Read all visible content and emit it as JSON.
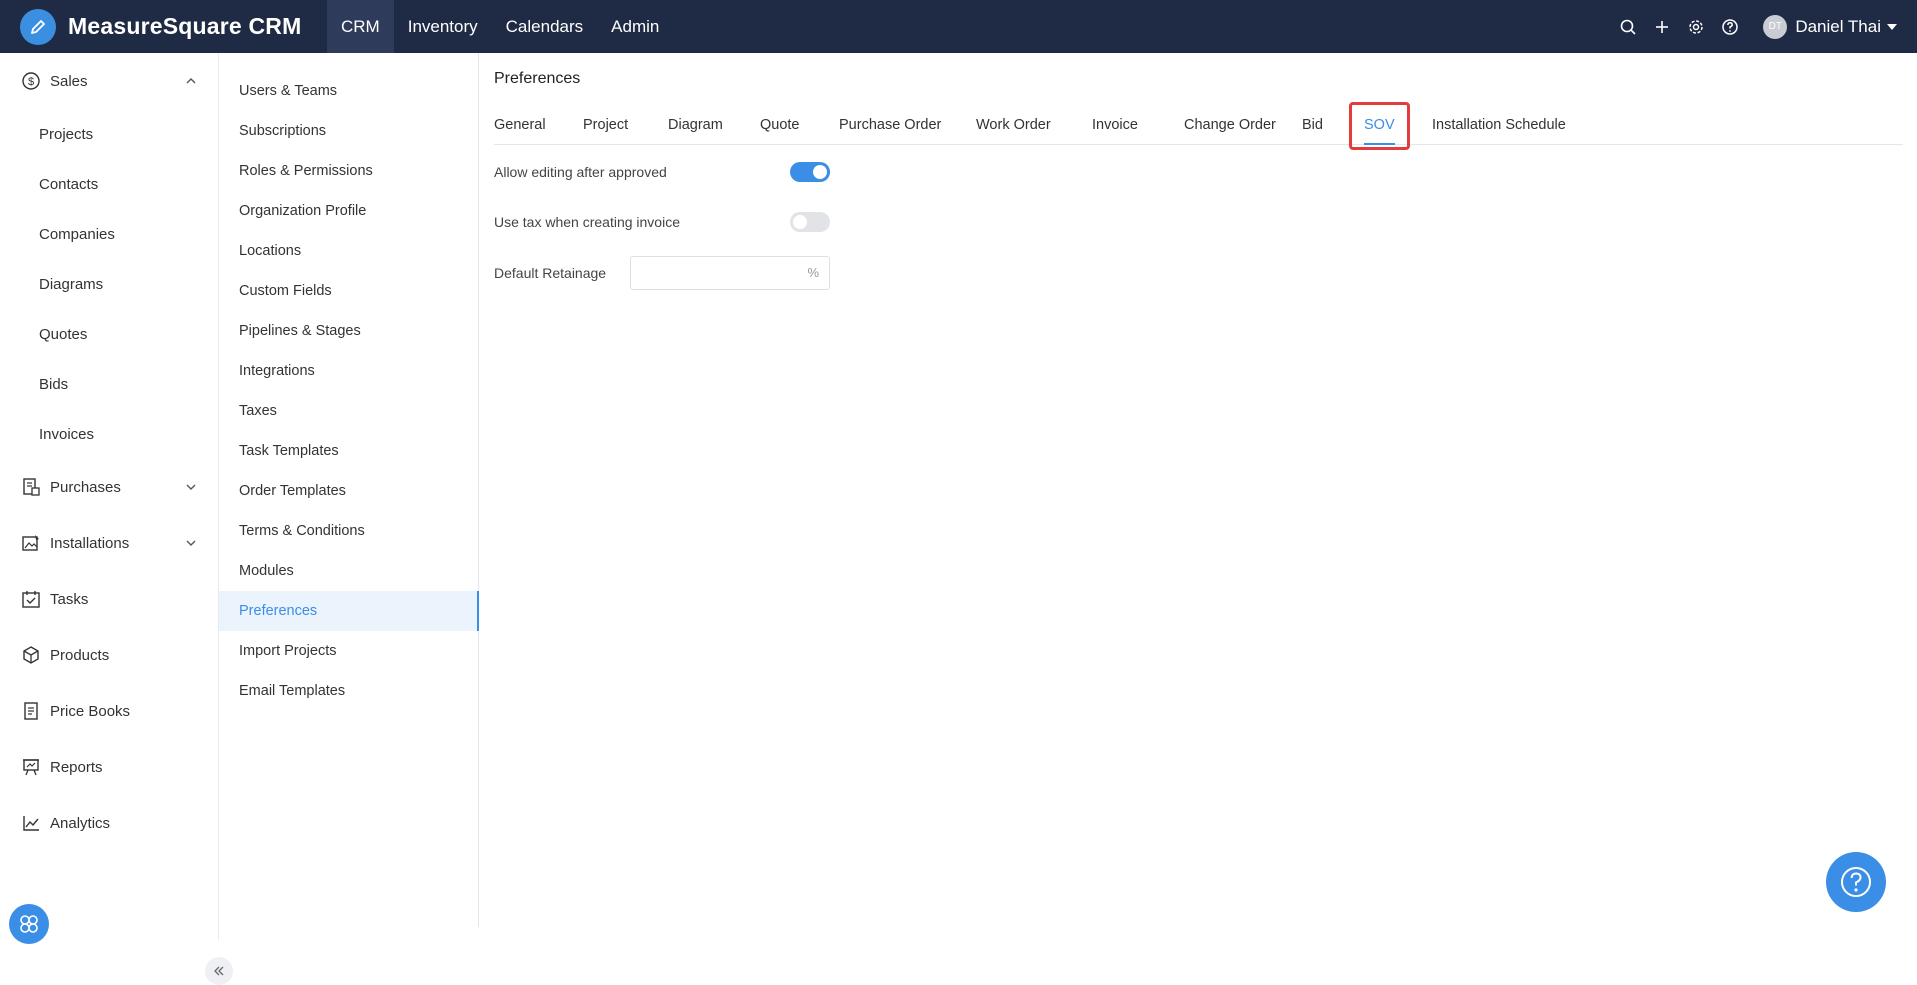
{
  "app": {
    "name": "MeasureSquare CRM",
    "accent": "#3a8ee6",
    "topbar_color": "#1f2a44"
  },
  "topnav": {
    "items": [
      {
        "label": "CRM",
        "active": true
      },
      {
        "label": "Inventory"
      },
      {
        "label": "Calendars"
      },
      {
        "label": "Admin"
      }
    ]
  },
  "topbar_icons": [
    "search-icon",
    "plus-icon",
    "gear-icon",
    "help-icon"
  ],
  "user": {
    "initials": "DT",
    "name": "Daniel Thai"
  },
  "sidebar": {
    "groups": [
      {
        "label": "Sales",
        "icon": "dollar-circle-icon",
        "expanded": true
      },
      {
        "label": "Purchases",
        "icon": "purchases-icon"
      },
      {
        "label": "Installations",
        "icon": "installations-icon"
      },
      {
        "label": "Tasks",
        "icon": "calendar-check-icon"
      },
      {
        "label": "Products",
        "icon": "box-icon"
      },
      {
        "label": "Price Books",
        "icon": "document-icon"
      },
      {
        "label": "Reports",
        "icon": "presentation-icon"
      },
      {
        "label": "Analytics",
        "icon": "line-chart-icon"
      }
    ],
    "sales_items": [
      "Projects",
      "Contacts",
      "Companies",
      "Diagrams",
      "Quotes",
      "Bids",
      "Invoices"
    ]
  },
  "settings_menu": {
    "items": [
      "Users & Teams",
      "Subscriptions",
      "Roles & Permissions",
      "Organization Profile",
      "Locations",
      "Custom Fields",
      "Pipelines & Stages",
      "Integrations",
      "Taxes",
      "Task Templates",
      "Order Templates",
      "Terms & Conditions",
      "Modules",
      "Preferences",
      "Import Projects",
      "Email Templates"
    ],
    "active": "Preferences"
  },
  "main": {
    "title": "Preferences",
    "tabs": [
      "General",
      "Project",
      "Diagram",
      "Quote",
      "Purchase Order",
      "Work Order",
      "Invoice",
      "Change Order",
      "Bid",
      "SOV",
      "Installation Schedule"
    ],
    "active_tab": "SOV",
    "settings": {
      "allow_editing_label": "Allow editing after approved",
      "allow_editing_on": true,
      "use_tax_label": "Use tax when creating invoice",
      "use_tax_on": false,
      "retainage_label": "Default Retainage",
      "retainage_value": "",
      "retainage_suffix": "%"
    }
  }
}
